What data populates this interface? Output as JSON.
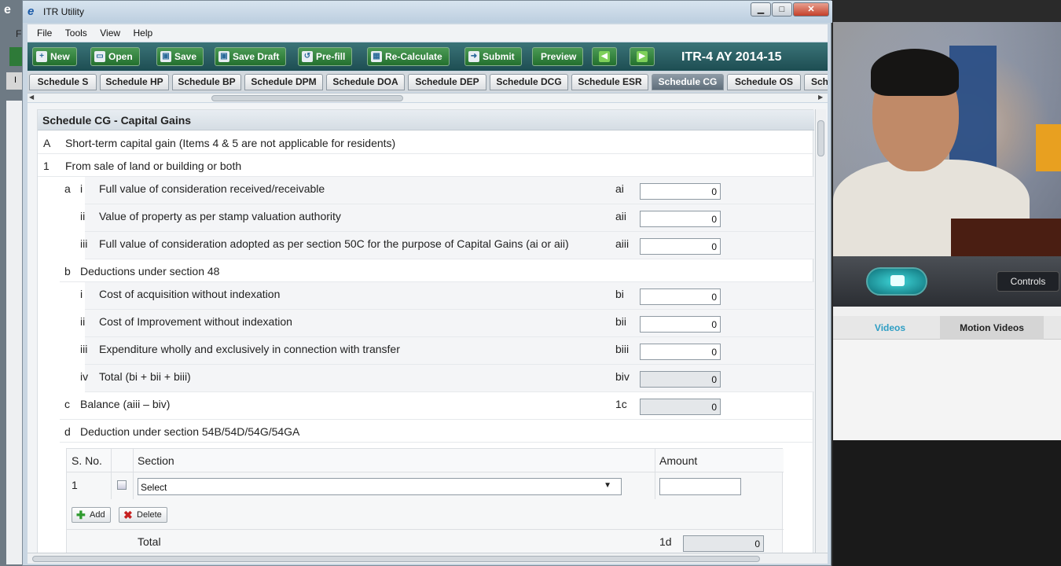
{
  "window": {
    "title": "ITR Utility",
    "min": "▁",
    "max": "□",
    "close": "✕"
  },
  "bg_app": {
    "letter": "F",
    "tab": "I"
  },
  "menu": [
    "File",
    "Tools",
    "View",
    "Help"
  ],
  "toolbar": {
    "new": "New",
    "open": "Open",
    "save": "Save",
    "save_draft": "Save Draft",
    "prefill": "Pre-fill",
    "recalculate": "Re-Calculate",
    "submit": "Submit",
    "preview": "Preview",
    "form_label": "ITR-4   AY 2014-15"
  },
  "tabs": [
    "Schedule S",
    "Schedule HP",
    "Schedule BP",
    "Schedule DPM",
    "Schedule DOA",
    "Schedule DEP",
    "Schedule DCG",
    "Schedule ESR",
    "Schedule CG",
    "Schedule OS",
    "Sch"
  ],
  "active_tab": "Schedule CG",
  "section": {
    "title": "Schedule CG - Capital Gains",
    "A_letter": "A",
    "A_text": "Short-term capital gain (Items 4 & 5 are not applicable for residents)",
    "one_num": "1",
    "one_text": "From sale of land or building or both",
    "a_letter": "a",
    "a_rows": [
      {
        "roman": "i",
        "text": "Full value of consideration received/receivable",
        "code": "ai",
        "value": "0"
      },
      {
        "roman": "ii",
        "text": "Value of property as per stamp valuation authority",
        "code": "aii",
        "value": "0"
      },
      {
        "roman": "iii",
        "text": "Full value of consideration adopted as per section 50C for the purpose of Capital Gains (ai or aii)",
        "code": "aiii",
        "value": "0"
      }
    ],
    "b_letter": "b",
    "b_text": "Deductions under section 48",
    "b_rows": [
      {
        "roman": "i",
        "text": "Cost of acquisition without indexation",
        "code": "bi",
        "value": "0"
      },
      {
        "roman": "ii",
        "text": "Cost of Improvement without indexation",
        "code": "bii",
        "value": "0"
      },
      {
        "roman": "iii",
        "text": "Expenditure wholly and exclusively in connection with transfer",
        "code": "biii",
        "value": "0"
      },
      {
        "roman": "iv",
        "text": "Total (bi + bii + biii)",
        "code": "biv",
        "value": "0"
      }
    ],
    "c_letter": "c",
    "c_text": "Balance (aiii – biv)",
    "c_code": "1c",
    "c_value": "0",
    "d_letter": "d",
    "d_text": "Deduction under section 54B/54D/54G/54GA"
  },
  "deduction_table": {
    "col_sno": "S. No.",
    "col_section": "Section",
    "col_amount": "Amount",
    "row_sno": "1",
    "select_value": "Select",
    "add_label": "Add",
    "delete_label": "Delete",
    "total_label": "Total",
    "total_code": "1d",
    "total_value": "0"
  },
  "video_panel": {
    "controls": "Controls",
    "tab_videos": "Videos",
    "tab_motion": "Motion Videos"
  }
}
